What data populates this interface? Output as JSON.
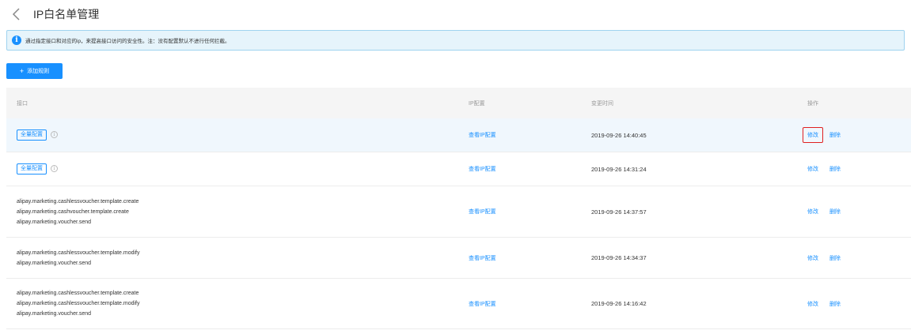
{
  "header": {
    "title": "IP白名单管理"
  },
  "notice": {
    "text": "通过指定接口和对应的ip，来提高接口访问的安全性。注：没有配置默认不进行任何拦截。"
  },
  "toolbar": {
    "add_label": "添加规则",
    "add_icon": "+"
  },
  "table": {
    "columns": {
      "api": "接口",
      "ip": "IP配置",
      "time": "变更时间",
      "op": "操作"
    },
    "rows": [
      {
        "tag": "全量配置",
        "apis": [],
        "ip_link": "查看IP配置",
        "time": "2019-09-26 14:40:45",
        "edit": "修改",
        "delete": "删除"
      },
      {
        "tag": "全量配置",
        "apis": [],
        "ip_link": "查看IP配置",
        "time": "2019-09-26 14:31:24",
        "edit": "修改",
        "delete": "删除"
      },
      {
        "tag": "",
        "apis": [
          "alipay.marketing.cashlessvoucher.template.create",
          "alipay.marketing.cashvoucher.template.create",
          "alipay.marketing.voucher.send"
        ],
        "ip_link": "查看IP配置",
        "time": "2019-09-26 14:37:57",
        "edit": "修改",
        "delete": "删除"
      },
      {
        "tag": "",
        "apis": [
          "alipay.marketing.cashlessvoucher.template.modify",
          "alipay.marketing.voucher.send"
        ],
        "ip_link": "查看IP配置",
        "time": "2019-09-26 14:34:37",
        "edit": "修改",
        "delete": "删除"
      },
      {
        "tag": "",
        "apis": [
          "alipay.marketing.cashlessvoucher.template.create",
          "alipay.marketing.cashlessvoucher.template.modify",
          "alipay.marketing.voucher.send"
        ],
        "ip_link": "查看IP配置",
        "time": "2019-09-26 14:16:42",
        "edit": "修改",
        "delete": "删除"
      }
    ]
  },
  "icons": {
    "back": "chevron-left-icon",
    "info": "info-circle-icon",
    "tip": "tip-circle-icon"
  },
  "colors": {
    "primary": "#1890ff",
    "notice_bg": "#e6f4fb",
    "highlight_box": "#e02020"
  }
}
